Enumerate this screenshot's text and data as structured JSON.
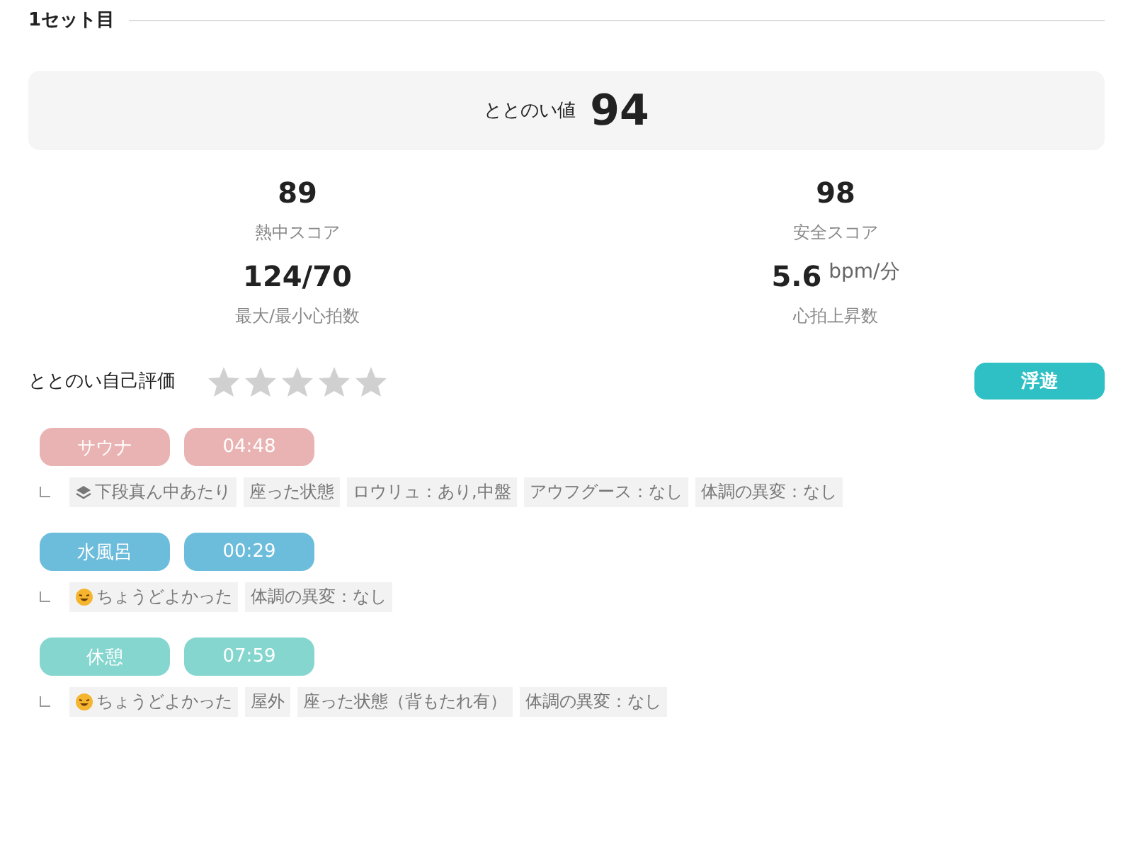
{
  "set_title": "1セット目",
  "totonoi": {
    "label": "ととのい値",
    "value": "94"
  },
  "stats": [
    {
      "value": "89",
      "label": "熱中スコア"
    },
    {
      "value": "98",
      "label": "安全スコア"
    },
    {
      "value": "124/70",
      "label": "最大/最小心拍数"
    },
    {
      "value": "5.6",
      "unit": "bpm/分",
      "label": "心拍上昇数"
    }
  ],
  "rating": {
    "label": "ととのい自己評価",
    "stars": 0,
    "badge": "浮遊"
  },
  "phases": [
    {
      "kind": "sauna",
      "name": "サウナ",
      "time": "04:48",
      "tags": [
        {
          "kind": "position",
          "text": "下段真ん中あたり"
        },
        {
          "kind": "plain",
          "text": "座った状態"
        },
        {
          "kind": "plain",
          "text": "ロウリュ：あり,中盤"
        },
        {
          "kind": "plain",
          "text": "アウフグース：なし"
        },
        {
          "kind": "plain",
          "text": "体調の異変：なし"
        }
      ]
    },
    {
      "kind": "water",
      "name": "水風呂",
      "time": "00:29",
      "tags": [
        {
          "kind": "feeling",
          "text": "ちょうどよかった"
        },
        {
          "kind": "plain",
          "text": "体調の異変：なし"
        }
      ]
    },
    {
      "kind": "rest",
      "name": "休憩",
      "time": "07:59",
      "tags": [
        {
          "kind": "feeling",
          "text": "ちょうどよかった"
        },
        {
          "kind": "plain",
          "text": "屋外"
        },
        {
          "kind": "plain",
          "text": "座った状態（背もたれ有）"
        },
        {
          "kind": "plain",
          "text": "体調の異変：なし"
        }
      ]
    }
  ]
}
